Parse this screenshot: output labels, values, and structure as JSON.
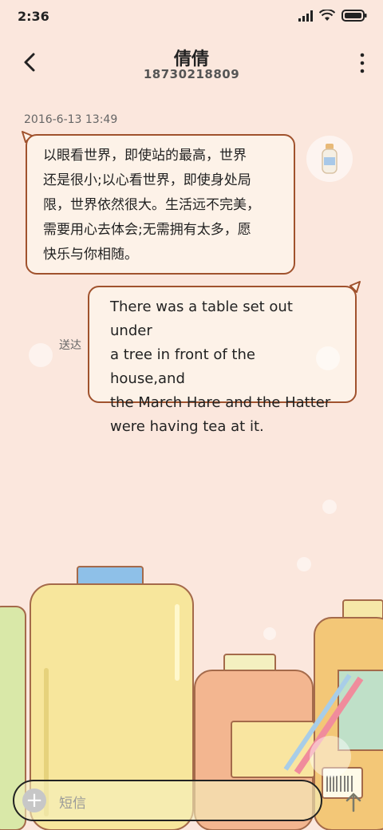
{
  "status_bar": {
    "time": "2:36"
  },
  "header": {
    "contact_name": "倩倩",
    "phone_number": "18730218809"
  },
  "conversation": {
    "timestamp": "2016-6-13 13:49",
    "messages": [
      {
        "direction": "incoming",
        "lines": [
          "以眼看世界，即使站的最高，世界",
          "还是很小;以心看世界，即使身处局",
          "限，世界依然很大。生活远不完美，",
          "需要用心去体会;无需拥有太多，愿",
          "快乐与你相随。"
        ]
      },
      {
        "direction": "outgoing",
        "lines": [
          "There was a table set out under",
          "a tree in front of the house,and",
          "the March Hare and the Hatter",
          "were having tea at it."
        ],
        "status": "送达"
      }
    ]
  },
  "input": {
    "placeholder": "短信"
  },
  "colors": {
    "background": "#fbe7dd",
    "bubble_border": "#a0522d",
    "bubble_fill": "#fdf2e8"
  },
  "icons": {
    "back": "back-arrow-icon",
    "more": "more-vertical-icon",
    "add": "plus-icon",
    "send": "send-arrow-icon"
  }
}
